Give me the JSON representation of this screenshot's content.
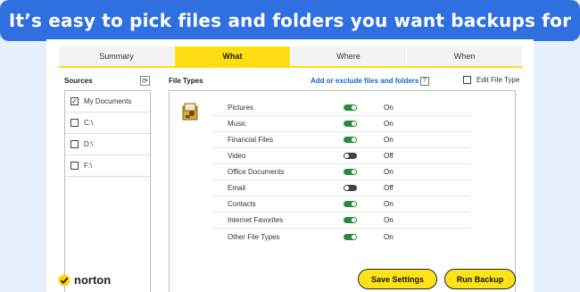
{
  "banner": {
    "title": "It’s easy to pick files and folders you want backups for"
  },
  "tabs": [
    {
      "label": "Summary",
      "active": false
    },
    {
      "label": "What",
      "active": true
    },
    {
      "label": "Where",
      "active": false
    },
    {
      "label": "When",
      "active": false
    }
  ],
  "sources": {
    "title": "Sources",
    "items": [
      {
        "label": "My Documents",
        "checked": true
      },
      {
        "label": "C:\\",
        "checked": false
      },
      {
        "label": "D:\\",
        "checked": false
      },
      {
        "label": "F:\\",
        "checked": false
      }
    ]
  },
  "file_types": {
    "title": "File Types",
    "add_link": "Add or exclude files and folders",
    "help": "?",
    "edit_label": "Edit File Type",
    "items": [
      {
        "label": "Pictures",
        "state": "On"
      },
      {
        "label": "Music",
        "state": "On"
      },
      {
        "label": "Financial Files",
        "state": "On"
      },
      {
        "label": "Video",
        "state": "Off"
      },
      {
        "label": "Office Documents",
        "state": "On"
      },
      {
        "label": "Email",
        "state": "Off"
      },
      {
        "label": "Contacts",
        "state": "On"
      },
      {
        "label": "Internet Favorites",
        "state": "On"
      },
      {
        "label": "Other File Types",
        "state": "On"
      }
    ]
  },
  "footer": {
    "brand": "norton",
    "save_label": "Save Settings",
    "run_label": "Run Backup"
  },
  "colors": {
    "accent": "#ffde11",
    "banner": "#2f6fe0",
    "toggle_on": "#2a8a3a",
    "link": "#1a63c9"
  }
}
